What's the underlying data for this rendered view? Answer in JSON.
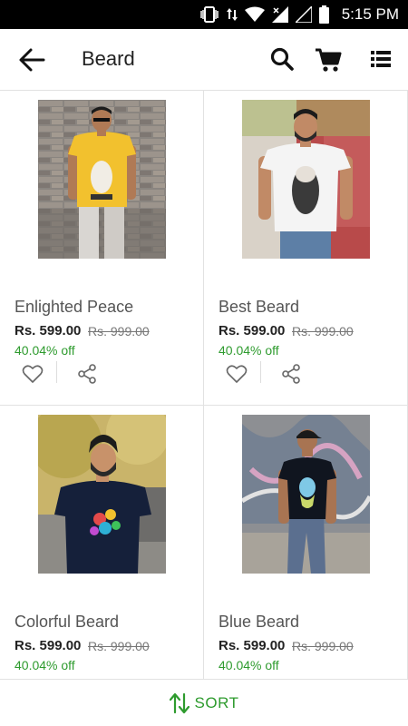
{
  "status_bar": {
    "time": "5:15 PM"
  },
  "app_bar": {
    "title": "Beard"
  },
  "products": [
    {
      "name": "Enlighted Peace",
      "price": "Rs. 599.00",
      "mrp": "Rs. 999.00",
      "discount": "40.04% off",
      "shirt_color": "#f2c12e",
      "bg": "brick-grey"
    },
    {
      "name": "Best Beard",
      "price": "Rs. 599.00",
      "mrp": "Rs. 999.00",
      "discount": "40.04% off",
      "shirt_color": "#f4f4f4",
      "bg": "brick-red"
    },
    {
      "name": "Colorful Beard",
      "price": "Rs. 599.00",
      "mrp": "Rs. 999.00",
      "discount": "40.04% off",
      "shirt_color": "#15203a",
      "bg": "trees"
    },
    {
      "name": "Blue Beard",
      "price": "Rs. 599.00",
      "mrp": "Rs. 999.00",
      "discount": "40.04% off",
      "shirt_color": "#10151f",
      "bg": "graffiti"
    }
  ],
  "sort_bar": {
    "label": "SORT"
  },
  "colors": {
    "accent": "#2e9b2e",
    "price": "#222222",
    "mrp": "#777777"
  }
}
